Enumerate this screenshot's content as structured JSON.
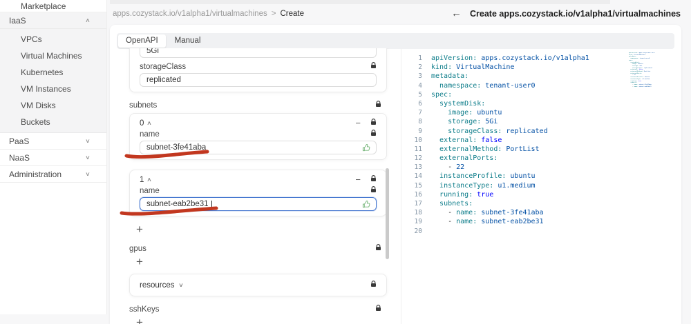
{
  "sidebar": {
    "marketplace": "Marketplace",
    "groups": [
      {
        "label": "IaaS",
        "expanded": true,
        "children": [
          "VPCs",
          "Virtual Machines",
          "Kubernetes",
          "VM Instances",
          "VM Disks",
          "Buckets"
        ]
      },
      {
        "label": "PaaS",
        "expanded": false
      },
      {
        "label": "NaaS",
        "expanded": false
      },
      {
        "label": "Administration",
        "expanded": false
      }
    ]
  },
  "breadcrumb": {
    "path": "apps.cozystack.io/v1alpha1/virtualmachines",
    "current": "Create"
  },
  "header": {
    "title": "Create apps.cozystack.io/v1alpha1/virtualmachines"
  },
  "tabs": {
    "openapi": "OpenAPI",
    "manual": "Manual"
  },
  "form": {
    "storage": {
      "value": "5Gi"
    },
    "storage_class": {
      "label": "storageClass",
      "value": "replicated"
    },
    "subnets": {
      "label": "subnets",
      "items": [
        {
          "index": "0",
          "field_label": "name",
          "value": "subnet-3fe41aba",
          "focused": false
        },
        {
          "index": "1",
          "field_label": "name",
          "value": "subnet-eab2be31",
          "focused": true
        }
      ]
    },
    "gpus": {
      "label": "gpus"
    },
    "resources": {
      "label": "resources"
    },
    "ssh_keys": {
      "label": "sshKeys"
    }
  },
  "icons": {
    "back-arrow": "←",
    "breadcrumb-separator": ">",
    "chevron-collapse": "∧",
    "chevron-expand": "∨",
    "add": "+",
    "remove": "−",
    "lock": "padlock",
    "approve": "thumbs-up"
  },
  "editor": {
    "lines": [
      [
        [
          "key",
          "apiVersion:"
        ],
        [
          "val",
          " apps.cozystack.io/v1alpha1"
        ]
      ],
      [
        [
          "key",
          "kind:"
        ],
        [
          "val",
          " VirtualMachine"
        ]
      ],
      [
        [
          "key",
          "metadata:"
        ]
      ],
      [
        [
          "plain",
          "  "
        ],
        [
          "key",
          "namespace:"
        ],
        [
          "val",
          " tenant-user0"
        ]
      ],
      [
        [
          "key",
          "spec:"
        ]
      ],
      [
        [
          "plain",
          "  "
        ],
        [
          "key",
          "systemDisk:"
        ]
      ],
      [
        [
          "plain",
          "    "
        ],
        [
          "key",
          "image:"
        ],
        [
          "val",
          " ubuntu"
        ]
      ],
      [
        [
          "plain",
          "    "
        ],
        [
          "key",
          "storage:"
        ],
        [
          "val",
          " 5Gi"
        ]
      ],
      [
        [
          "plain",
          "    "
        ],
        [
          "key",
          "storageClass:"
        ],
        [
          "val",
          " replicated"
        ]
      ],
      [
        [
          "plain",
          "  "
        ],
        [
          "key",
          "external:"
        ],
        [
          "kw",
          " false"
        ]
      ],
      [
        [
          "plain",
          "  "
        ],
        [
          "key",
          "externalMethod:"
        ],
        [
          "val",
          " PortList"
        ]
      ],
      [
        [
          "plain",
          "  "
        ],
        [
          "key",
          "externalPorts:"
        ]
      ],
      [
        [
          "plain",
          "    - "
        ],
        [
          "num",
          "22"
        ]
      ],
      [
        [
          "plain",
          "  "
        ],
        [
          "key",
          "instanceProfile:"
        ],
        [
          "val",
          " ubuntu"
        ]
      ],
      [
        [
          "plain",
          "  "
        ],
        [
          "key",
          "instanceType:"
        ],
        [
          "val",
          " u1.medium"
        ]
      ],
      [
        [
          "plain",
          "  "
        ],
        [
          "key",
          "running:"
        ],
        [
          "kw",
          " true"
        ]
      ],
      [
        [
          "plain",
          "  "
        ],
        [
          "key",
          "subnets:"
        ]
      ],
      [
        [
          "plain",
          "    - "
        ],
        [
          "key",
          "name:"
        ],
        [
          "val",
          " subnet-3fe41aba"
        ]
      ],
      [
        [
          "plain",
          "    - "
        ],
        [
          "key",
          "name:"
        ],
        [
          "val",
          " subnet-eab2be31"
        ]
      ],
      []
    ],
    "colors": {
      "key": "#0e7d8a",
      "val": "#0451a5",
      "kw": "#0000ff",
      "num": "#0451a5",
      "plain": "#333333",
      "line_number": "#8596a6"
    }
  },
  "annotations": {
    "underline_color": "#c2371f"
  },
  "colors": {
    "focus_border": "#4879d0",
    "thumb_green": "#74b578",
    "lock": "#3a3a3a",
    "sidebar_group_bg": "#f4f4f5"
  }
}
